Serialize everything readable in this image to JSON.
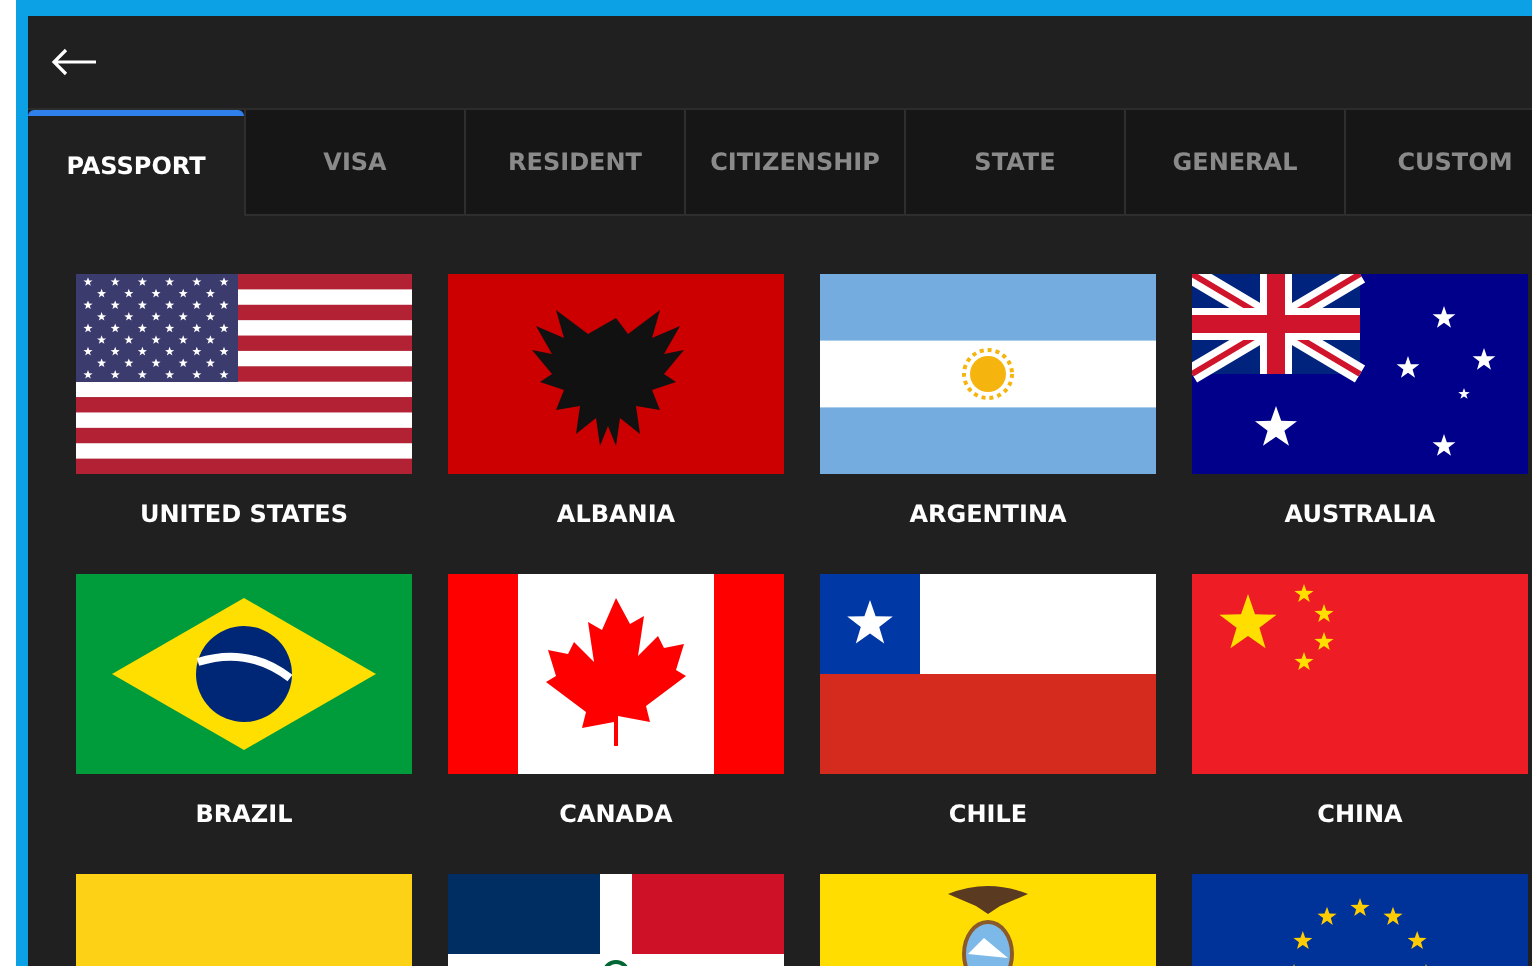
{
  "tabs": [
    {
      "label": "PASSPORT",
      "selected": true
    },
    {
      "label": "VISA",
      "selected": false
    },
    {
      "label": "RESIDENT",
      "selected": false
    },
    {
      "label": "CITIZENSHIP",
      "selected": false
    },
    {
      "label": "STATE",
      "selected": false
    },
    {
      "label": "GENERAL",
      "selected": false
    },
    {
      "label": "CUSTOM",
      "selected": false
    }
  ],
  "flags": [
    {
      "kind": "united_states",
      "label": "UNITED STATES"
    },
    {
      "kind": "albania",
      "label": "ALBANIA"
    },
    {
      "kind": "argentina",
      "label": "ARGENTINA"
    },
    {
      "kind": "australia",
      "label": "AUSTRALIA"
    },
    {
      "kind": "brazil",
      "label": "BRAZIL"
    },
    {
      "kind": "canada",
      "label": "CANADA"
    },
    {
      "kind": "chile",
      "label": "CHILE"
    },
    {
      "kind": "china",
      "label": "CHINA"
    },
    {
      "kind": "colombia"
    },
    {
      "kind": "dominican_republic"
    },
    {
      "kind": "ecuador"
    },
    {
      "kind": "european_union"
    }
  ]
}
